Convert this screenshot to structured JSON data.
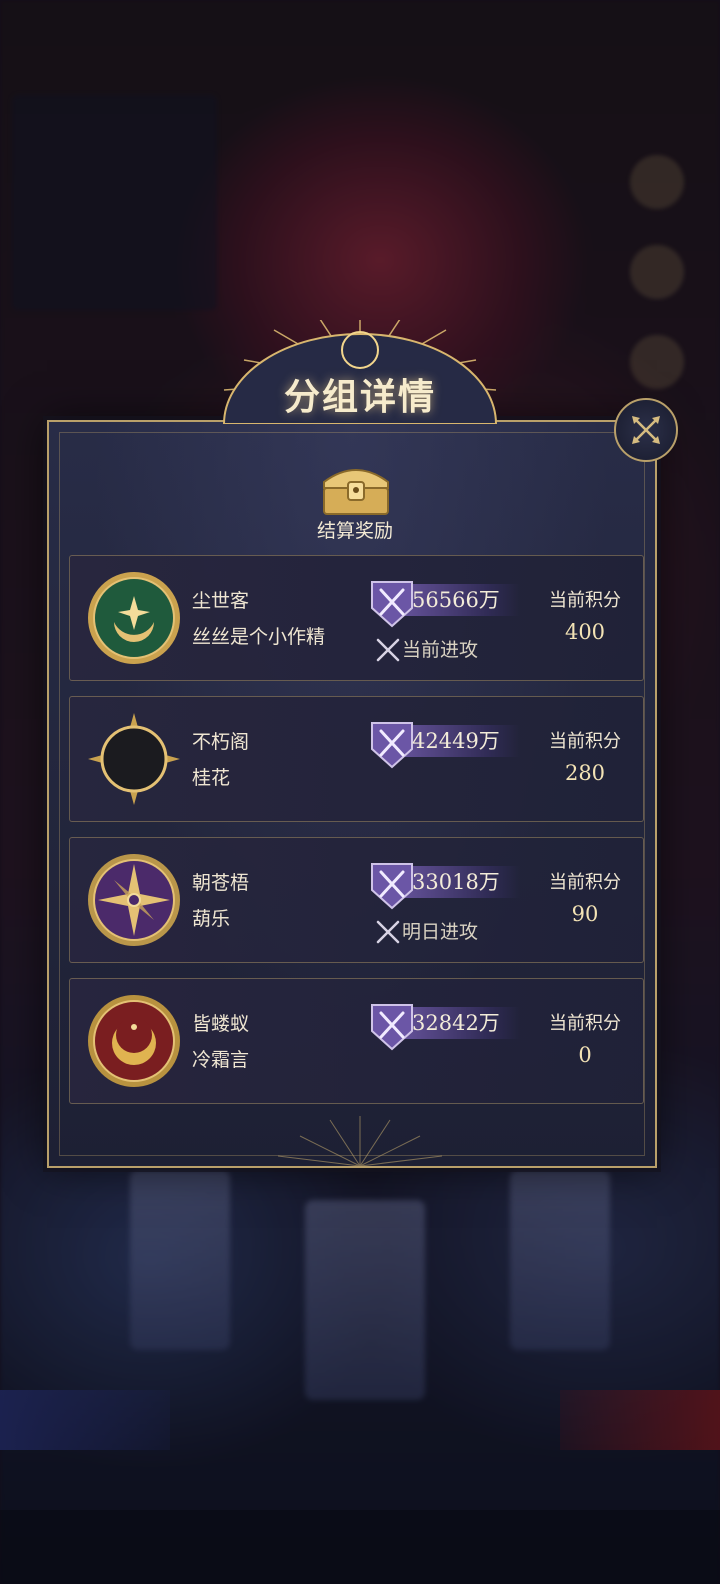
{
  "title": "分组详情",
  "reward": {
    "label": "结算奖励",
    "icon": "treasure-chest-icon"
  },
  "close_icon": "close-icon",
  "score_label": "当前积分",
  "groups": [
    {
      "guild": "尘世客",
      "leader": "丝丝是个小作精",
      "power": "56566万",
      "status": "当前进攻",
      "score": "400",
      "emblem": "green-star-moon-emblem",
      "emblem_color": "#1f5a3c"
    },
    {
      "guild": "不朽阁",
      "leader": "桂花",
      "power": "42449万",
      "status": "",
      "score": "280",
      "emblem": "black-gold-moon-emblem",
      "emblem_color": "#1b1b1f"
    },
    {
      "guild": "朝苍梧",
      "leader": "葫乐",
      "power": "33018万",
      "status": "明日进攻",
      "score": "90",
      "emblem": "purple-compass-emblem",
      "emblem_color": "#4b2a6a"
    },
    {
      "guild": "皆蝼蚁",
      "leader": "冷霜言",
      "power": "32842万",
      "status": "",
      "score": "0",
      "emblem": "red-crescent-emblem",
      "emblem_color": "#7a1e20"
    }
  ],
  "colors": {
    "gold": "#b9a06a",
    "panel": "#22253b",
    "power_bar": "#6955a0"
  }
}
